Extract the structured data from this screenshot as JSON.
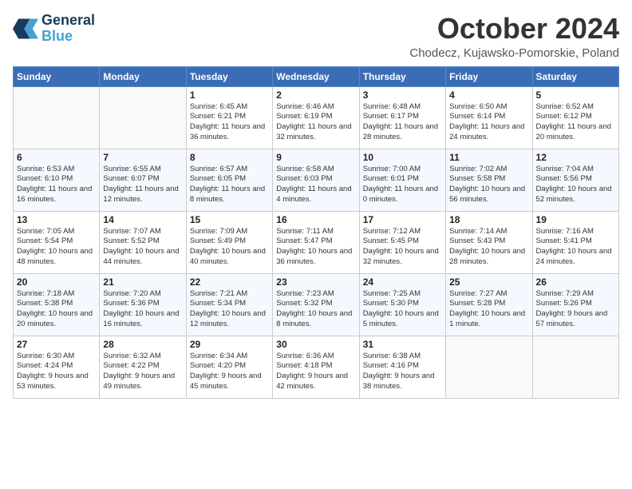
{
  "header": {
    "logo_line1": "General",
    "logo_line2": "Blue",
    "month": "October 2024",
    "location": "Chodecz, Kujawsko-Pomorskie, Poland"
  },
  "days_of_week": [
    "Sunday",
    "Monday",
    "Tuesday",
    "Wednesday",
    "Thursday",
    "Friday",
    "Saturday"
  ],
  "weeks": [
    [
      {
        "day": "",
        "info": ""
      },
      {
        "day": "",
        "info": ""
      },
      {
        "day": "1",
        "info": "Sunrise: 6:45 AM\nSunset: 6:21 PM\nDaylight: 11 hours\nand 36 minutes."
      },
      {
        "day": "2",
        "info": "Sunrise: 6:46 AM\nSunset: 6:19 PM\nDaylight: 11 hours\nand 32 minutes."
      },
      {
        "day": "3",
        "info": "Sunrise: 6:48 AM\nSunset: 6:17 PM\nDaylight: 11 hours\nand 28 minutes."
      },
      {
        "day": "4",
        "info": "Sunrise: 6:50 AM\nSunset: 6:14 PM\nDaylight: 11 hours\nand 24 minutes."
      },
      {
        "day": "5",
        "info": "Sunrise: 6:52 AM\nSunset: 6:12 PM\nDaylight: 11 hours\nand 20 minutes."
      }
    ],
    [
      {
        "day": "6",
        "info": "Sunrise: 6:53 AM\nSunset: 6:10 PM\nDaylight: 11 hours\nand 16 minutes."
      },
      {
        "day": "7",
        "info": "Sunrise: 6:55 AM\nSunset: 6:07 PM\nDaylight: 11 hours\nand 12 minutes."
      },
      {
        "day": "8",
        "info": "Sunrise: 6:57 AM\nSunset: 6:05 PM\nDaylight: 11 hours\nand 8 minutes."
      },
      {
        "day": "9",
        "info": "Sunrise: 6:58 AM\nSunset: 6:03 PM\nDaylight: 11 hours\nand 4 minutes."
      },
      {
        "day": "10",
        "info": "Sunrise: 7:00 AM\nSunset: 6:01 PM\nDaylight: 11 hours\nand 0 minutes."
      },
      {
        "day": "11",
        "info": "Sunrise: 7:02 AM\nSunset: 5:58 PM\nDaylight: 10 hours\nand 56 minutes."
      },
      {
        "day": "12",
        "info": "Sunrise: 7:04 AM\nSunset: 5:56 PM\nDaylight: 10 hours\nand 52 minutes."
      }
    ],
    [
      {
        "day": "13",
        "info": "Sunrise: 7:05 AM\nSunset: 5:54 PM\nDaylight: 10 hours\nand 48 minutes."
      },
      {
        "day": "14",
        "info": "Sunrise: 7:07 AM\nSunset: 5:52 PM\nDaylight: 10 hours\nand 44 minutes."
      },
      {
        "day": "15",
        "info": "Sunrise: 7:09 AM\nSunset: 5:49 PM\nDaylight: 10 hours\nand 40 minutes."
      },
      {
        "day": "16",
        "info": "Sunrise: 7:11 AM\nSunset: 5:47 PM\nDaylight: 10 hours\nand 36 minutes."
      },
      {
        "day": "17",
        "info": "Sunrise: 7:12 AM\nSunset: 5:45 PM\nDaylight: 10 hours\nand 32 minutes."
      },
      {
        "day": "18",
        "info": "Sunrise: 7:14 AM\nSunset: 5:43 PM\nDaylight: 10 hours\nand 28 minutes."
      },
      {
        "day": "19",
        "info": "Sunrise: 7:16 AM\nSunset: 5:41 PM\nDaylight: 10 hours\nand 24 minutes."
      }
    ],
    [
      {
        "day": "20",
        "info": "Sunrise: 7:18 AM\nSunset: 5:38 PM\nDaylight: 10 hours\nand 20 minutes."
      },
      {
        "day": "21",
        "info": "Sunrise: 7:20 AM\nSunset: 5:36 PM\nDaylight: 10 hours\nand 16 minutes."
      },
      {
        "day": "22",
        "info": "Sunrise: 7:21 AM\nSunset: 5:34 PM\nDaylight: 10 hours\nand 12 minutes."
      },
      {
        "day": "23",
        "info": "Sunrise: 7:23 AM\nSunset: 5:32 PM\nDaylight: 10 hours\nand 8 minutes."
      },
      {
        "day": "24",
        "info": "Sunrise: 7:25 AM\nSunset: 5:30 PM\nDaylight: 10 hours\nand 5 minutes."
      },
      {
        "day": "25",
        "info": "Sunrise: 7:27 AM\nSunset: 5:28 PM\nDaylight: 10 hours\nand 1 minute."
      },
      {
        "day": "26",
        "info": "Sunrise: 7:29 AM\nSunset: 5:26 PM\nDaylight: 9 hours\nand 57 minutes."
      }
    ],
    [
      {
        "day": "27",
        "info": "Sunrise: 6:30 AM\nSunset: 4:24 PM\nDaylight: 9 hours\nand 53 minutes."
      },
      {
        "day": "28",
        "info": "Sunrise: 6:32 AM\nSunset: 4:22 PM\nDaylight: 9 hours\nand 49 minutes."
      },
      {
        "day": "29",
        "info": "Sunrise: 6:34 AM\nSunset: 4:20 PM\nDaylight: 9 hours\nand 45 minutes."
      },
      {
        "day": "30",
        "info": "Sunrise: 6:36 AM\nSunset: 4:18 PM\nDaylight: 9 hours\nand 42 minutes."
      },
      {
        "day": "31",
        "info": "Sunrise: 6:38 AM\nSunset: 4:16 PM\nDaylight: 9 hours\nand 38 minutes."
      },
      {
        "day": "",
        "info": ""
      },
      {
        "day": "",
        "info": ""
      }
    ]
  ]
}
